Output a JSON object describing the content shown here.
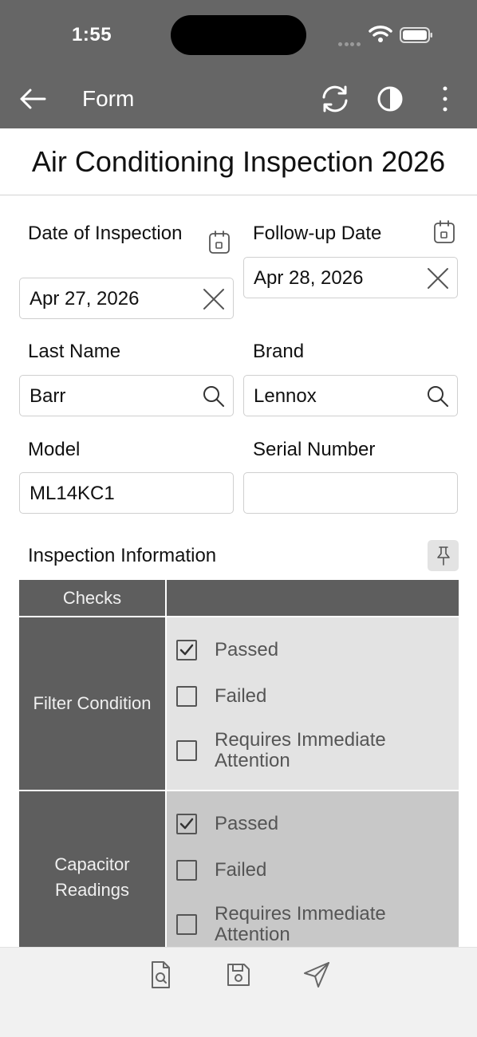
{
  "status_bar": {
    "time": "1:55"
  },
  "app_bar": {
    "title": "Form",
    "icons": [
      "back-arrow-icon",
      "sync-icon",
      "contrast-icon",
      "more-vertical-icon"
    ]
  },
  "form": {
    "title": "Air Conditioning Inspection 2026",
    "date_of_inspection": {
      "label": "Date of Inspection",
      "value": "Apr 27, 2026"
    },
    "follow_up_date": {
      "label": "Follow-up Date",
      "value": "Apr 28, 2026"
    },
    "last_name": {
      "label": "Last Name",
      "value": "Barr"
    },
    "brand": {
      "label": "Brand",
      "value": "Lennox"
    },
    "model": {
      "label": "Model",
      "value": "ML14KC1"
    },
    "serial_number": {
      "label": "Serial Number",
      "value": ""
    }
  },
  "inspection": {
    "section_label": "Inspection Information",
    "column_header": "Checks",
    "rows": [
      {
        "label": "Filter Condition",
        "options": [
          {
            "label": "Passed",
            "checked": true
          },
          {
            "label": "Failed",
            "checked": false
          },
          {
            "label": "Requires Immediate Attention",
            "checked": false
          }
        ]
      },
      {
        "label": "Capacitor Readings",
        "options": [
          {
            "label": "Passed",
            "checked": true
          },
          {
            "label": "Failed",
            "checked": false
          },
          {
            "label": "Requires Immediate Attention",
            "checked": false
          }
        ]
      }
    ]
  },
  "colors": {
    "app_bar": "#666666",
    "grid_header": "#5e5e5e",
    "row1_bg": "#e3e3e3",
    "row2_bg": "#c8c8c8",
    "bottom_bar": "#f1f1f1"
  },
  "bottom_bar": {
    "icons": [
      "preview-document-icon",
      "save-icon",
      "send-icon"
    ]
  }
}
